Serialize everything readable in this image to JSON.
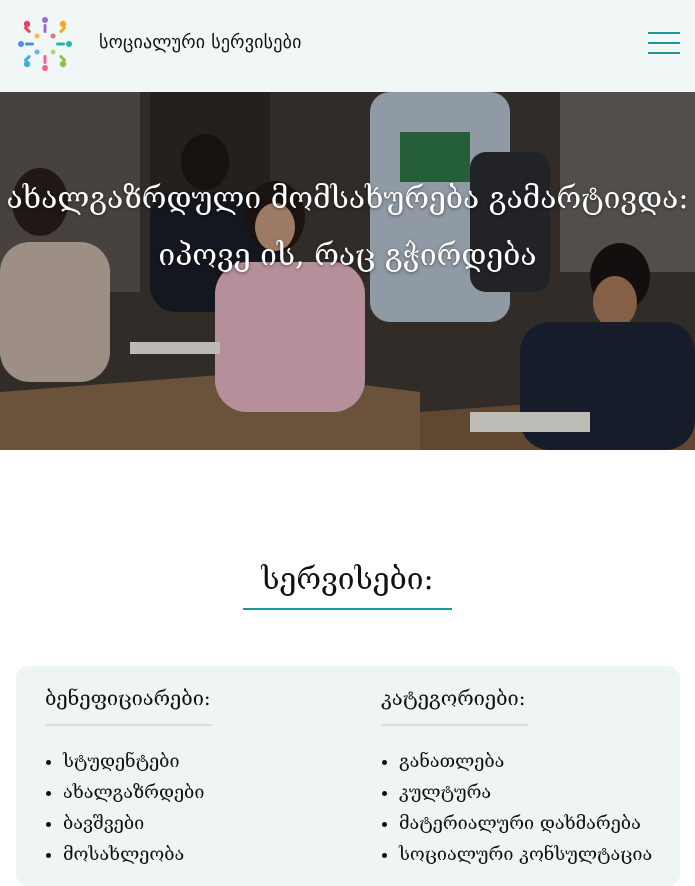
{
  "header": {
    "site_name": "სოციალური სერვისები",
    "logo_icon": "colorful-people-circle-logo-icon",
    "menu_icon": "hamburger-menu-icon",
    "accent_color": "#1c9a96"
  },
  "hero": {
    "title_line1": "ახალგაზრდული მომსახურება გამარტივდა:",
    "title_line2": "იპოვე ის, რაც გჭირდება"
  },
  "services": {
    "heading": "სერვისები:",
    "beneficiaries": {
      "title": "ბენეფიციარები:",
      "items": [
        "სტუდენტები",
        "ახალგაზრდები",
        "ბავშვები",
        "მოსახლეობა"
      ]
    },
    "categories": {
      "title": "კატეგორიები:",
      "items": [
        "განათლება",
        "კულტურა",
        "მატერიალური დახმარება",
        "სოციალური კონსულტაცია"
      ]
    }
  }
}
